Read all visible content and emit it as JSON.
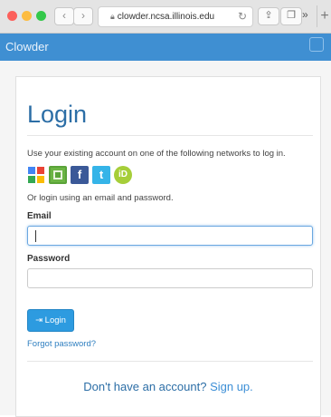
{
  "browser": {
    "url": "clowder.ncsa.illinois.edu",
    "back_icon": "chevron-left",
    "forward_icon": "chevron-right",
    "reload_icon": "reload",
    "share_icon": "share",
    "tabs_icon": "tabs",
    "more_label": "»",
    "new_tab_label": "+",
    "traffic_lights": [
      "#fc605b",
      "#fdbc40",
      "#34c84a"
    ]
  },
  "app": {
    "brand": "Clowder",
    "accent": "#3f8fd2"
  },
  "login": {
    "title": "Login",
    "intro": "Use your existing account on one of the following networks to log in.",
    "providers": [
      {
        "name": "google",
        "glyph": "8",
        "color": "#dd4b39"
      },
      {
        "name": "crowd",
        "glyph": "▣",
        "color": "#5aa339"
      },
      {
        "name": "facebook",
        "glyph": "f",
        "color": "#3b5998"
      },
      {
        "name": "twitter",
        "glyph": "t",
        "color": "#35b4e8"
      },
      {
        "name": "orcid",
        "glyph": "iD",
        "color": "#a6ce39"
      }
    ],
    "alt_text": "Or login using an email and password.",
    "email_label": "Email",
    "email_value": "",
    "password_label": "Password",
    "password_value": "",
    "submit_label": "Login",
    "forgot_label": "Forgot password?",
    "signup_prompt": "Don't have an account?",
    "signup_link": "Sign up."
  }
}
